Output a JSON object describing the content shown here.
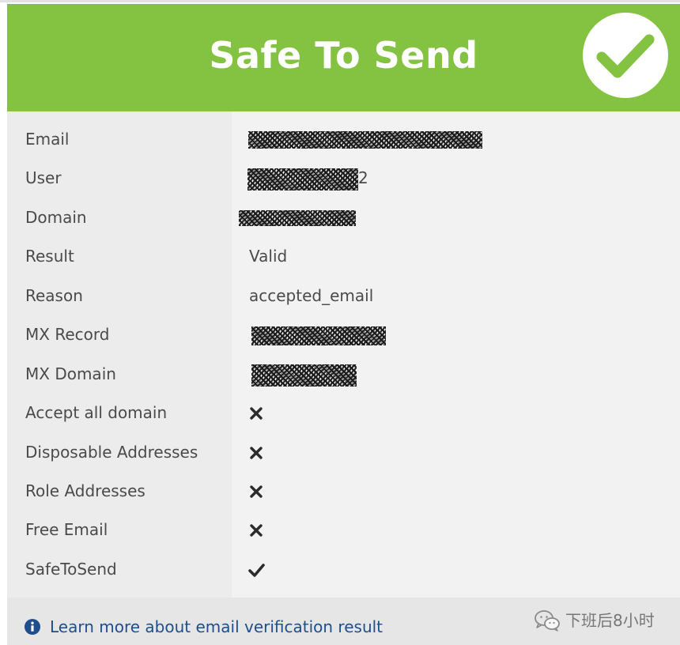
{
  "header": {
    "title": "Safe To Send",
    "status_icon": "check-circle-icon",
    "color": "#83c341"
  },
  "rows": [
    {
      "label": "Email",
      "value": "",
      "type": "redacted"
    },
    {
      "label": "User",
      "value": "2",
      "type": "redacted-suffix"
    },
    {
      "label": "Domain",
      "value": "",
      "type": "redacted"
    },
    {
      "label": "Result",
      "value": "Valid",
      "type": "text"
    },
    {
      "label": "Reason",
      "value": "accepted_email",
      "type": "text"
    },
    {
      "label": "MX Record",
      "value": "",
      "type": "redacted"
    },
    {
      "label": "MX Domain",
      "value": "",
      "type": "redacted"
    },
    {
      "label": "Accept all domain",
      "value": "no",
      "type": "icon",
      "icon": "x-icon"
    },
    {
      "label": "Disposable Addresses",
      "value": "no",
      "type": "icon",
      "icon": "x-icon"
    },
    {
      "label": "Role Addresses",
      "value": "no",
      "type": "icon",
      "icon": "x-icon"
    },
    {
      "label": "Free Email",
      "value": "no",
      "type": "icon",
      "icon": "x-icon"
    },
    {
      "label": "SafeToSend",
      "value": "yes",
      "type": "icon",
      "icon": "check-icon"
    }
  ],
  "footer": {
    "info_icon": "info-icon",
    "link_text": "Learn more about email verification result",
    "link_color": "#1f4e8c"
  },
  "watermark": {
    "icon": "wechat-icon",
    "text": "下班后8小时"
  }
}
